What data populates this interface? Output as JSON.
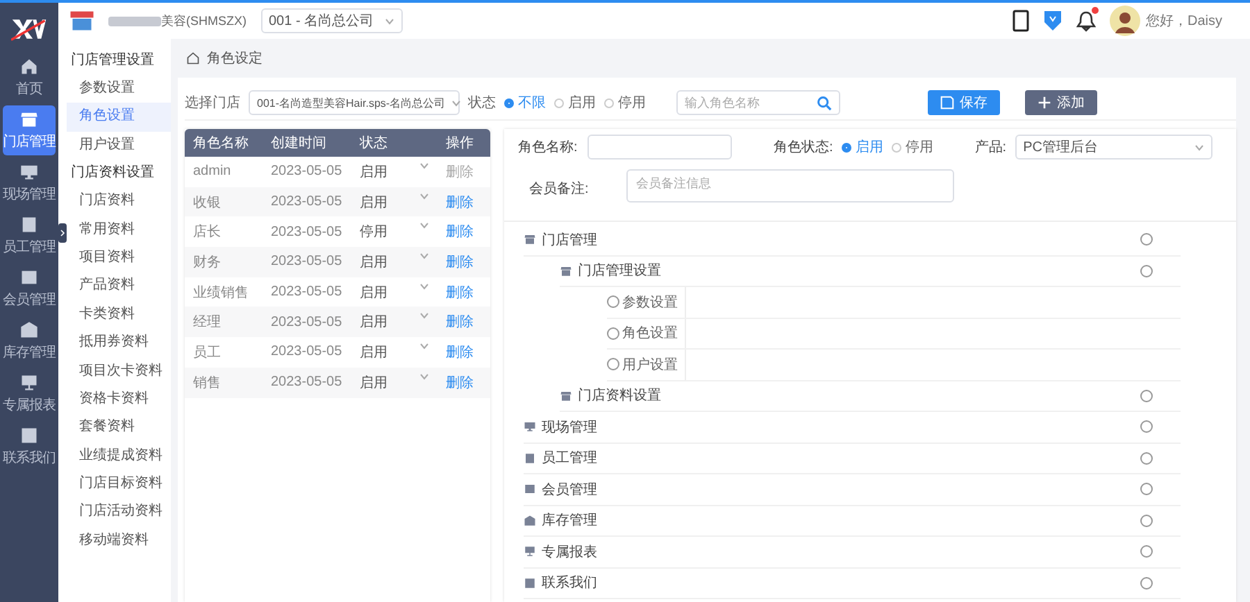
{
  "header": {
    "company": "美容(SHMSZX)",
    "store_select": "001 - 名尚总公司",
    "greeting": "您好，Daisy",
    "notification_badge": true
  },
  "nav": [
    {
      "label": "首页",
      "selected": false
    },
    {
      "label": "门店管理",
      "selected": true
    },
    {
      "label": "现场管理",
      "selected": false
    },
    {
      "label": "员工管理",
      "selected": false
    },
    {
      "label": "会员管理",
      "selected": false
    },
    {
      "label": "库存管理",
      "selected": false
    },
    {
      "label": "专属报表",
      "selected": false
    },
    {
      "label": "联系我们",
      "selected": false
    }
  ],
  "submenu": [
    {
      "title": "门店管理设置",
      "items": [
        {
          "label": "参数设置",
          "selected": false
        },
        {
          "label": "角色设置",
          "selected": true
        },
        {
          "label": "用户设置",
          "selected": false
        }
      ]
    },
    {
      "title": "门店资料设置",
      "items": [
        {
          "label": "门店资料",
          "selected": false
        },
        {
          "label": "常用资料",
          "selected": false
        },
        {
          "label": "项目资料",
          "selected": false
        },
        {
          "label": "产品资料",
          "selected": false
        },
        {
          "label": "卡类资料",
          "selected": false
        },
        {
          "label": "抵用券资料",
          "selected": false
        },
        {
          "label": "项目次卡资料",
          "selected": false
        },
        {
          "label": "资格卡资料",
          "selected": false
        },
        {
          "label": "套餐资料",
          "selected": false
        },
        {
          "label": "业绩提成资料",
          "selected": false
        },
        {
          "label": "门店目标资料",
          "selected": false
        },
        {
          "label": "门店活动资料",
          "selected": false
        },
        {
          "label": "移动端资料",
          "selected": false
        }
      ]
    }
  ],
  "breadcrumb": "角色设定",
  "filter": {
    "store_label": "选择门店",
    "store_value": "001-名尚造型美容Hair.sps-名尚总公司",
    "status_label": "状态",
    "status_options": [
      {
        "label": "不限",
        "selected": true
      },
      {
        "label": "启用",
        "selected": false
      },
      {
        "label": "停用",
        "selected": false
      }
    ],
    "search_placeholder": "输入角色名称"
  },
  "buttons": [
    {
      "label": "保存",
      "kind": "save"
    },
    {
      "label": "添加",
      "kind": "add"
    }
  ],
  "table": {
    "columns": [
      "角色名称",
      "创建时间",
      "状态",
      "操作"
    ],
    "rows": [
      {
        "name": "admin",
        "created": "2023-05-05",
        "status": "启用",
        "action": "删除",
        "disabled": true
      },
      {
        "name": "收银",
        "created": "2023-05-05",
        "status": "启用",
        "action": "删除",
        "disabled": false
      },
      {
        "name": "店长",
        "created": "2023-05-05",
        "status": "停用",
        "action": "删除",
        "disabled": false
      },
      {
        "name": "财务",
        "created": "2023-05-05",
        "status": "启用",
        "action": "删除",
        "disabled": false
      },
      {
        "name": "业绩销售",
        "created": "2023-05-05",
        "status": "启用",
        "action": "删除",
        "disabled": false
      },
      {
        "name": "经理",
        "created": "2023-05-05",
        "status": "启用",
        "action": "删除",
        "disabled": false
      },
      {
        "name": "员工",
        "created": "2023-05-05",
        "status": "启用",
        "action": "删除",
        "disabled": false
      },
      {
        "name": "销售",
        "created": "2023-05-05",
        "status": "启用",
        "action": "删除",
        "disabled": false
      }
    ]
  },
  "form": {
    "name_label": "角色名称:",
    "status_label": "角色状态:",
    "status_options": [
      {
        "label": "启用",
        "selected": true
      },
      {
        "label": "停用",
        "selected": false
      }
    ],
    "product_label": "产品:",
    "product_value": "PC管理后台",
    "remark_label": "会员备注:",
    "remark_placeholder": "会员备注信息"
  },
  "permissions": [
    {
      "label": "门店管理",
      "checked": false,
      "children": [
        {
          "label": "门店管理设置",
          "checked": false,
          "children": [
            {
              "label": "参数设置",
              "checked": false
            },
            {
              "label": "角色设置",
              "checked": false
            },
            {
              "label": "用户设置",
              "checked": false
            }
          ]
        },
        {
          "label": "门店资料设置",
          "checked": false
        }
      ]
    },
    {
      "label": "现场管理",
      "checked": false
    },
    {
      "label": "员工管理",
      "checked": false
    },
    {
      "label": "会员管理",
      "checked": false
    },
    {
      "label": "库存管理",
      "checked": false
    },
    {
      "label": "专属报表",
      "checked": false
    },
    {
      "label": "联系我们",
      "checked": false
    }
  ]
}
